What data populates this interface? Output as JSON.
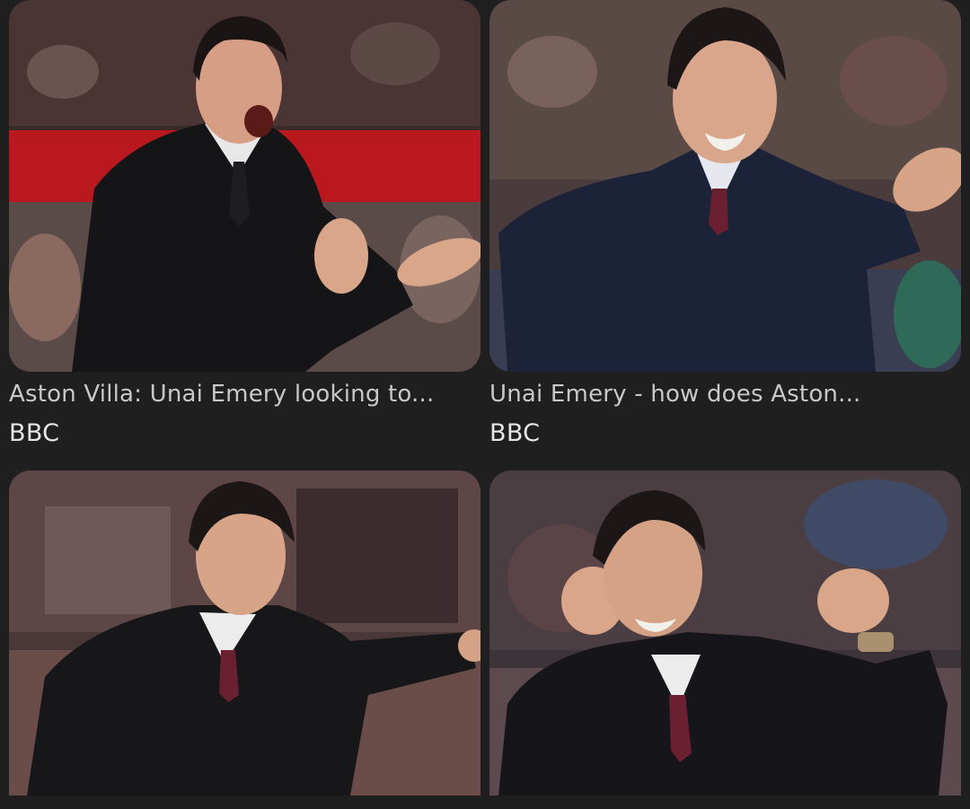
{
  "results": [
    {
      "caption": "Aston Villa: Unai Emery looking to...",
      "source": "BBC",
      "image_icon": "photo-manager-shouting-clapping"
    },
    {
      "caption": "Unai Emery - how does Aston...",
      "source": "BBC",
      "image_icon": "photo-manager-arms-wide"
    },
    {
      "caption": "",
      "source": "",
      "image_icon": "photo-manager-pointing"
    },
    {
      "caption": "",
      "source": "",
      "image_icon": "photo-manager-fist-pump"
    }
  ],
  "colors": {
    "background": "#1f1f1f",
    "caption_text": "#c8c8c8",
    "source_text": "#e6e6e6"
  }
}
